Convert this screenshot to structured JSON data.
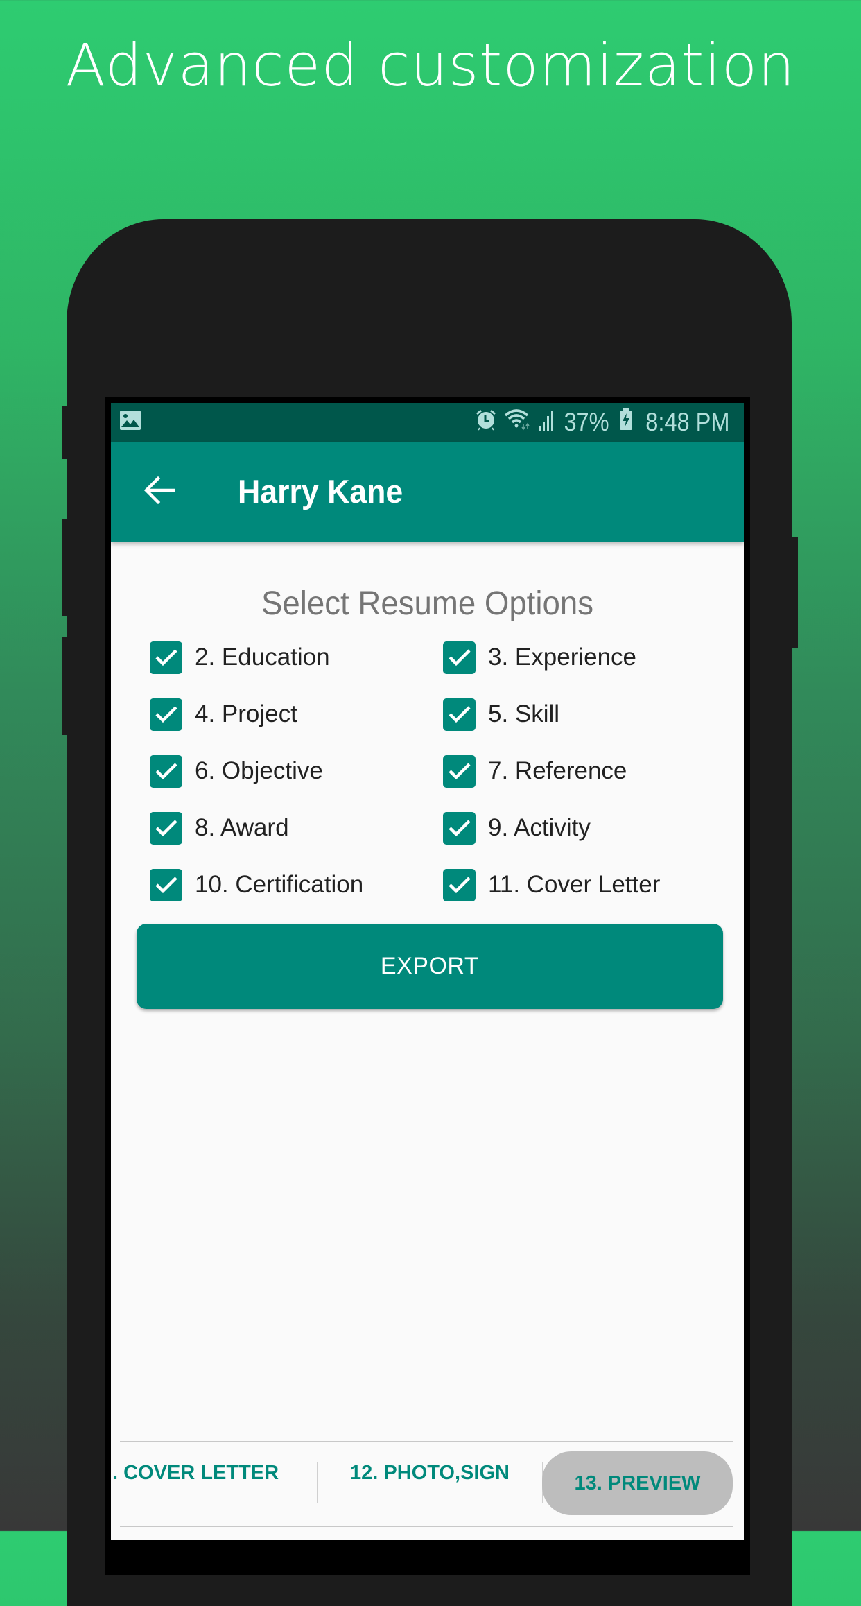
{
  "promo": {
    "headline": "Advanced customization"
  },
  "colors": {
    "primary": "#00897b",
    "primary_dark": "#00574b",
    "background_top": "#2ecc71",
    "background_bottom": "#383838",
    "phone_body": "#1c1c1c",
    "status_text": "#b2dfdb",
    "active_tab_bg": "#bdbdbd"
  },
  "status_bar": {
    "left_icon": "image-notification-icon",
    "icons": [
      "alarm-icon",
      "wifi-icon",
      "signal-icon",
      "battery-charging-icon"
    ],
    "battery": "37%",
    "time": "8:48 PM"
  },
  "app_bar": {
    "back_icon": "arrow-back-icon",
    "title": "Harry Kane"
  },
  "main": {
    "section_title": "Select Resume Options",
    "options": [
      {
        "label": "2. Education",
        "checked": true
      },
      {
        "label": "3. Experience",
        "checked": true
      },
      {
        "label": "4. Project",
        "checked": true
      },
      {
        "label": "5. Skill",
        "checked": true
      },
      {
        "label": "6. Objective",
        "checked": true
      },
      {
        "label": "7. Reference",
        "checked": true
      },
      {
        "label": "8. Award",
        "checked": true
      },
      {
        "label": "9. Activity",
        "checked": true
      },
      {
        "label": "10. Certification",
        "checked": true
      },
      {
        "label": "11. Cover Letter",
        "checked": true
      }
    ],
    "export_label": "EXPORT"
  },
  "bottom_tabs": [
    {
      "label": ". COVER LETTER",
      "active": false
    },
    {
      "label": "12. PHOTO,SIGN",
      "active": false
    },
    {
      "label": "13. PREVIEW",
      "active": true
    }
  ]
}
